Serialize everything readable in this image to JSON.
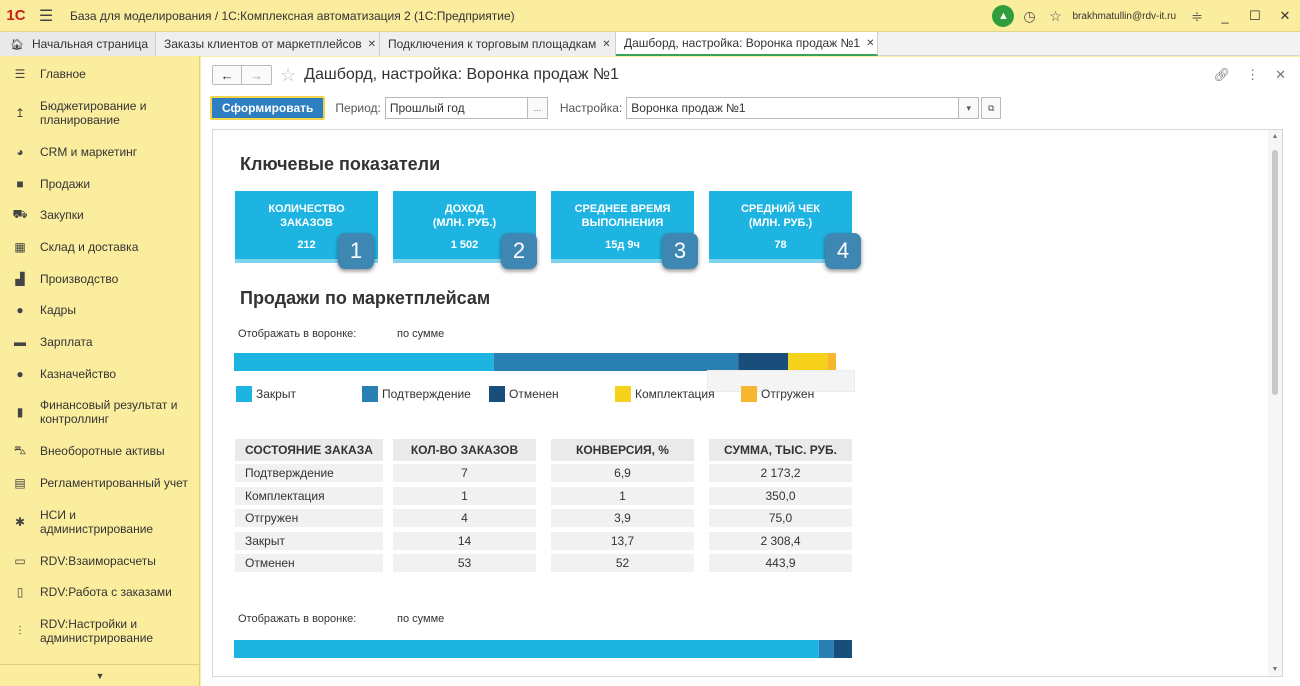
{
  "app": {
    "logo": "1С",
    "title": "База для моделирования / 1С:Комплексная автоматизация 2  (1С:Предприятие)",
    "user": "brakhmatullin@rdv-it.ru"
  },
  "tabs": [
    {
      "label": "Начальная страница"
    },
    {
      "label": "Заказы клиентов от маркетплейсов"
    },
    {
      "label": "Подключения к торговым площадкам"
    },
    {
      "label": "Дашборд, настройка: Воронка продаж №1"
    }
  ],
  "sidebar": {
    "items": [
      {
        "label": "Главное",
        "icon": "menu-icon"
      },
      {
        "label": "Бюджетирование и планирование",
        "icon": "budget-icon"
      },
      {
        "label": "CRM и маркетинг",
        "icon": "crm-icon"
      },
      {
        "label": "Продажи",
        "icon": "sales-icon"
      },
      {
        "label": "Закупки",
        "icon": "cart-icon"
      },
      {
        "label": "Склад и доставка",
        "icon": "warehouse-icon"
      },
      {
        "label": "Производство",
        "icon": "factory-icon"
      },
      {
        "label": "Кадры",
        "icon": "person-icon"
      },
      {
        "label": "Зарплата",
        "icon": "salary-icon"
      },
      {
        "label": "Казначейство",
        "icon": "treasury-icon"
      },
      {
        "label": "Финансовый результат и контроллинг",
        "icon": "chart-icon"
      },
      {
        "label": "Внеоборотные активы",
        "icon": "assets-icon"
      },
      {
        "label": "Регламентированный учет",
        "icon": "accounting-icon"
      },
      {
        "label": "НСИ и администрирование",
        "icon": "gear-icon"
      },
      {
        "label": "RDV:Взаиморасчеты",
        "icon": "doc-icon"
      },
      {
        "label": "RDV:Работа с заказами",
        "icon": "orders-icon"
      },
      {
        "label": "RDV:Настройки и администрирование",
        "icon": "settings-icon"
      }
    ]
  },
  "form": {
    "title": "Дашборд, настройка: Воронка продаж №1",
    "generate_button": "Сформировать",
    "period_label": "Период:",
    "period_value": "Прошлый год",
    "period_btn": "...",
    "setting_label": "Настройка:",
    "setting_value": "Воронка продаж №1"
  },
  "report": {
    "kpi_title": "Ключевые показатели",
    "kpis": [
      {
        "line1": "КОЛИЧЕСТВО",
        "line2": "ЗАКАЗОВ",
        "value": "212",
        "badge": "1"
      },
      {
        "line1": "ДОХОД",
        "line2": "(МЛН. РУБ.)",
        "value": "1 502",
        "badge": "2"
      },
      {
        "line1": "СРЕДНЕЕ ВРЕМЯ",
        "line2": "ВЫПОЛНЕНИЯ",
        "value": "15д 9ч",
        "badge": "3"
      },
      {
        "line1": "СРЕДНИЙ ЧЕК",
        "line2": "(МЛН. РУБ.)",
        "value": "78",
        "badge": "4"
      }
    ],
    "sales_title": "Продажи по маркетплейсам",
    "funnel_label": "Отображать в воронке:",
    "funnel_value": "по сумме",
    "table_headers": [
      "СОСТОЯНИЕ ЗАКАЗА",
      "КОЛ-ВО ЗАКАЗОВ",
      "КОНВЕРСИЯ, %",
      "СУММА, ТЫС. РУБ."
    ],
    "table_rows": [
      [
        "Подтверждение",
        "7",
        "6,9",
        "2 173,2"
      ],
      [
        "Комплектация",
        "1",
        "1",
        "350,0"
      ],
      [
        "Отгружен",
        "4",
        "3,9",
        "75,0"
      ],
      [
        "Закрыт",
        "14",
        "13,7",
        "2 308,4"
      ],
      [
        "Отменен",
        "53",
        "52",
        "443,9"
      ]
    ]
  },
  "chart_data": [
    {
      "type": "bar",
      "orientation": "horizontal-stacked",
      "series": [
        {
          "name": "Закрыт",
          "color": "#1eb4e2",
          "values": [
            2308.4
          ]
        },
        {
          "name": "Подтверждение",
          "color": "#2a7fb2",
          "values": [
            2173.2
          ]
        },
        {
          "name": "Отменен",
          "color": "#1a4e7a",
          "values": [
            443.9
          ]
        },
        {
          "name": "Комплектация",
          "color": "#f7d21b",
          "values": [
            350.0
          ]
        },
        {
          "name": "Отгружен",
          "color": "#f6b62e",
          "values": [
            75.0
          ]
        }
      ],
      "legend": "bottom"
    },
    {
      "type": "bar",
      "orientation": "horizontal-stacked",
      "series": [
        {
          "color": "#1eb4e2",
          "values": [
            583
          ]
        },
        {
          "color": "#2a7fb2",
          "values": [
            15
          ]
        },
        {
          "color": "#1a4e7a",
          "values": [
            18
          ]
        }
      ]
    }
  ],
  "colors": {
    "kpi": "#1eb4e2",
    "badge": "#3f87b3",
    "primary_button": "#2d7fc1"
  }
}
